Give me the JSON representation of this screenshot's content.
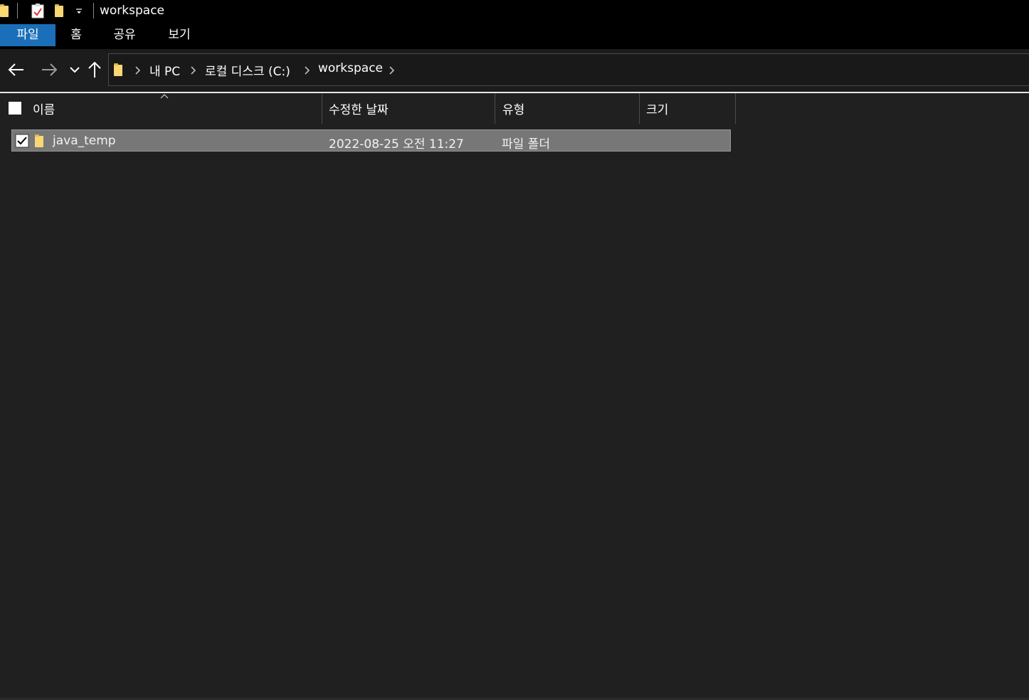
{
  "window": {
    "title": "workspace"
  },
  "ribbon": {
    "tabs": [
      {
        "label": "파일",
        "active": true
      },
      {
        "label": "홈",
        "active": false
      },
      {
        "label": "공유",
        "active": false
      },
      {
        "label": "보기",
        "active": false
      }
    ]
  },
  "breadcrumb": {
    "items": [
      "내 PC",
      "로컬 디스크 (C:)",
      "workspace"
    ]
  },
  "columns": {
    "name": "이름",
    "date": "수정한 날짜",
    "type": "유형",
    "size": "크기"
  },
  "files": [
    {
      "name": "java_temp",
      "modified": "2022-08-25 오전 11:27",
      "type": "파일 폴더",
      "size": "",
      "selected": true,
      "checked": true
    }
  ],
  "colors": {
    "accent": "#1a6fb8",
    "folder": "#f8d775",
    "background": "#202020",
    "selected_row": "#777777"
  },
  "icons": [
    "folder-icon",
    "properties-icon",
    "new-folder-icon",
    "customize-dropdown-icon",
    "back-arrow-icon",
    "forward-arrow-icon",
    "recent-locations-icon",
    "up-arrow-icon",
    "chevron-right-icon",
    "sort-ascending-icon",
    "checkbox-icon"
  ]
}
